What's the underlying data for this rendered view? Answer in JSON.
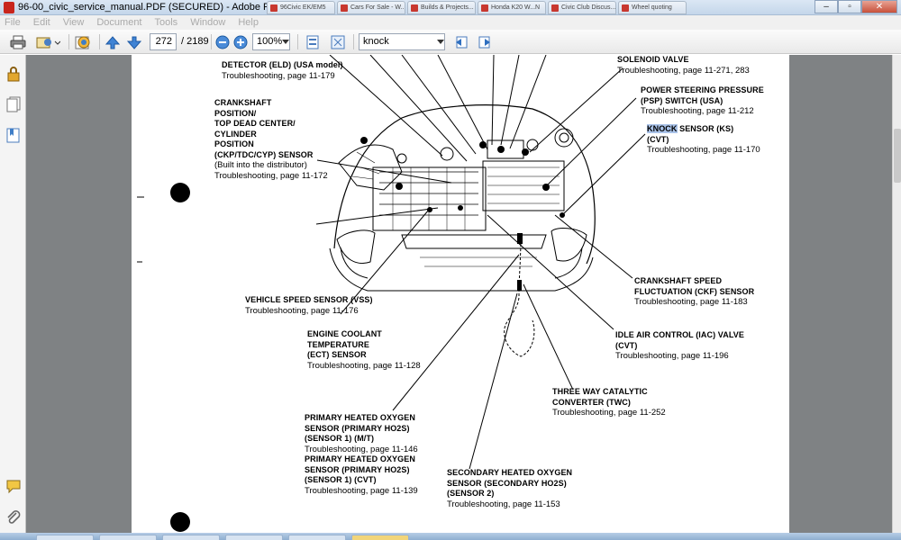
{
  "window": {
    "title": "96-00_civic_service_manual.PDF (SECURED) - Adobe Reader",
    "background_tabs": [
      "96Civic EK/EM5",
      "Cars For Sale - W...",
      "Builds & Projects...",
      "Honda K20 W...N",
      "Civic Club Discus...",
      "Wheel quoting"
    ]
  },
  "menu": [
    "File",
    "Edit",
    "View",
    "Document",
    "Tools",
    "Window",
    "Help"
  ],
  "toolbar": {
    "page_current": "272",
    "page_total": "/ 2189",
    "zoom": "100%",
    "search_text": "knock"
  },
  "labels": {
    "eld_title": "DETECTOR (ELD) (USA model)",
    "eld_ts": "Troubleshooting, page 11-179",
    "ckp_1": "CRANKSHAFT",
    "ckp_2": "POSITION/",
    "ckp_3": "TOP DEAD CENTER/",
    "ckp_4": "CYLINDER",
    "ckp_5": "POSITION",
    "ckp_6": "(CKP/TDC/CYP) SENSOR",
    "ckp_7": "(Built into the distributor)",
    "ckp_ts": "Troubleshooting, page 11-172",
    "solenoid_title": "SOLENOID VALVE",
    "solenoid_ts": "Troubleshooting, page 11-271, 283",
    "psp_1": "POWER STEERING PRESSURE",
    "psp_2": "(PSP) SWITCH (USA)",
    "psp_ts": "Troubleshooting, page 11-212",
    "ks_highlight": "KNOCK",
    "ks_rest": " SENSOR (KS)",
    "ks_2": "(CVT)",
    "ks_ts": "Troubleshooting, page 11-170",
    "vss_title": "VEHICLE SPEED SENSOR (VSS)",
    "vss_ts": "Troubleshooting, page 11-176",
    "ckf_1": "CRANKSHAFT SPEED",
    "ckf_2": "FLUCTUATION (CKF) SENSOR",
    "ckf_ts": "Troubleshooting, page 11-183",
    "ect_1": "ENGINE COOLANT",
    "ect_2": "TEMPERATURE",
    "ect_3": "(ECT) SENSOR",
    "ect_ts": "Troubleshooting, page 11-128",
    "iac_1": "IDLE AIR CONTROL (IAC) VALVE",
    "iac_2": "(CVT)",
    "iac_ts": "Troubleshooting, page 11-196",
    "twc_1": "THREE WAY CATALYTIC",
    "twc_2": "CONVERTER (TWC)",
    "twc_ts": "Troubleshooting, page 11-252",
    "ho2s_1": "PRIMARY HEATED OXYGEN",
    "ho2s_2": "SENSOR (PRIMARY HO2S)",
    "ho2s_3": "(SENSOR 1) (M/T)",
    "ho2s_ts1": "Troubleshooting, page 11-146",
    "ho2s_4": "PRIMARY HEATED OXYGEN",
    "ho2s_5": "SENSOR (PRIMARY HO2S)",
    "ho2s_6": "(SENSOR 1) (CVT)",
    "ho2s_ts2": "Troubleshooting, page 11-139",
    "sho2s_1": "SECONDARY HEATED OXYGEN",
    "sho2s_2": "SENSOR (SECONDARY HO2S)",
    "sho2s_3": "(SENSOR 2)",
    "sho2s_ts": "Troubleshooting, page 11-153"
  }
}
